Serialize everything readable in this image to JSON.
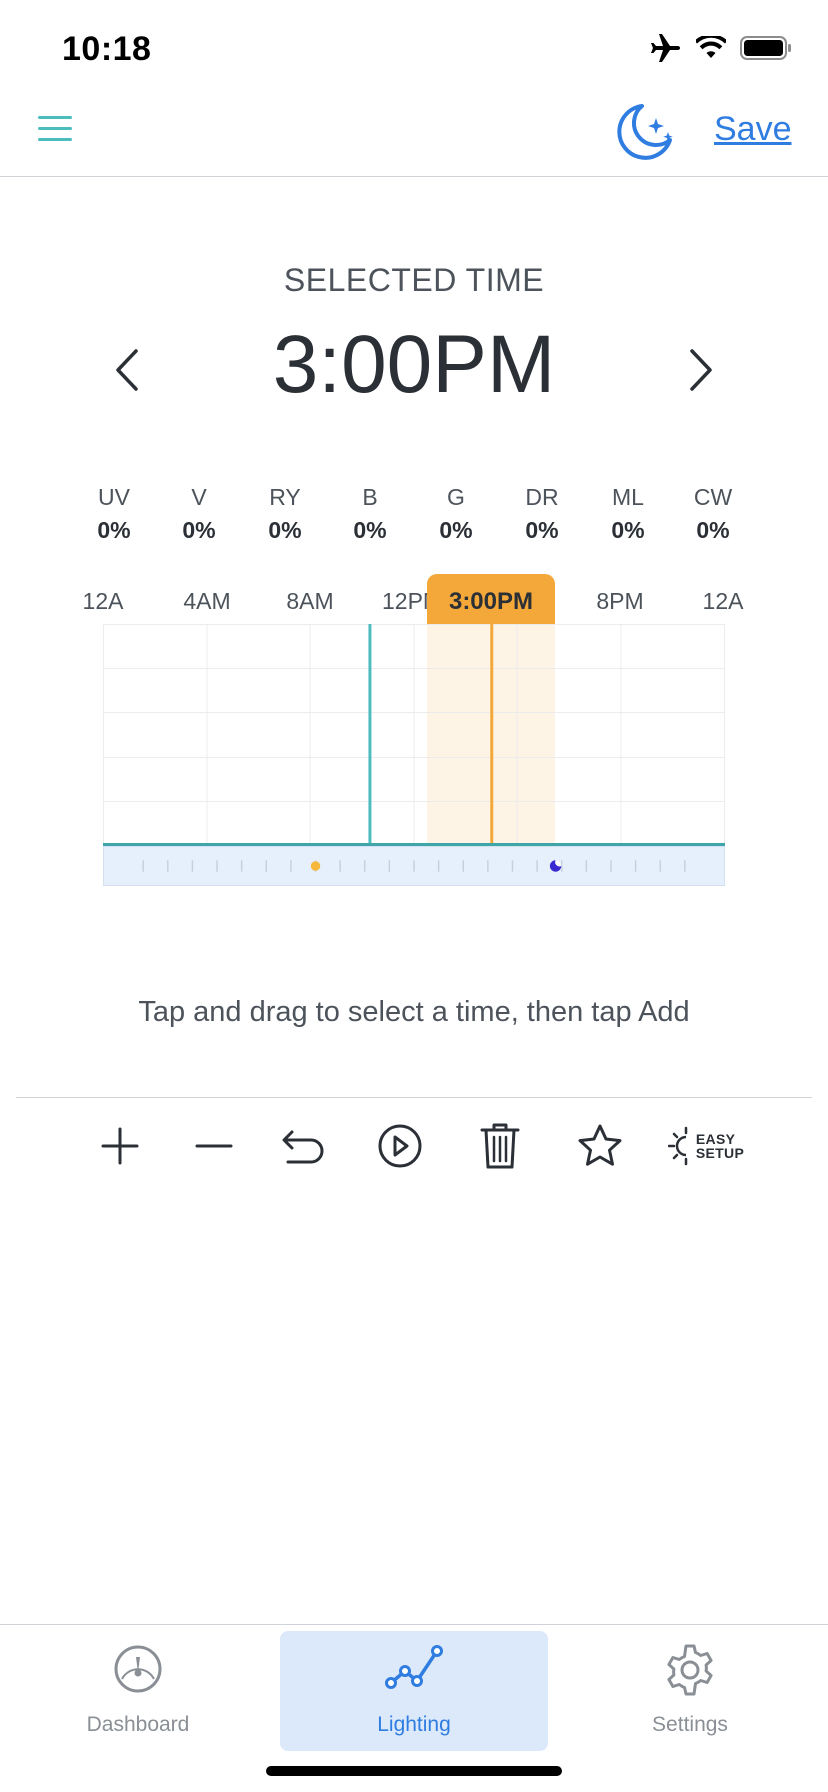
{
  "status_bar": {
    "time": "10:18"
  },
  "nav": {
    "save_label": "Save"
  },
  "selected": {
    "label": "SELECTED TIME",
    "time": "3:00PM"
  },
  "channels": [
    {
      "name": "UV",
      "value": "0%"
    },
    {
      "name": "V",
      "value": "0%"
    },
    {
      "name": "RY",
      "value": "0%"
    },
    {
      "name": "B",
      "value": "0%"
    },
    {
      "name": "G",
      "value": "0%"
    },
    {
      "name": "DR",
      "value": "0%"
    },
    {
      "name": "ML",
      "value": "0%"
    },
    {
      "name": "CW",
      "value": "0%"
    }
  ],
  "chart": {
    "time_labels": [
      "12A",
      "4AM",
      "8AM",
      "12PM",
      "8PM",
      "12A"
    ],
    "selected_label": "3:00PM",
    "selected_hour": 15,
    "now_hour": 10.3,
    "sunrise_hour": 8,
    "moonrise_hour": 17.75
  },
  "hint": "Tap and drag to select a time, then tap Add",
  "toolbar": {
    "easy_line1": "EASY",
    "easy_line2": "SETUP"
  },
  "tabs": [
    {
      "label": "Dashboard"
    },
    {
      "label": "Lighting"
    },
    {
      "label": "Settings"
    }
  ],
  "colors": {
    "accent_teal": "#4cbdbf",
    "accent_blue": "#2f7de1",
    "selection_orange": "#f4a83a"
  }
}
